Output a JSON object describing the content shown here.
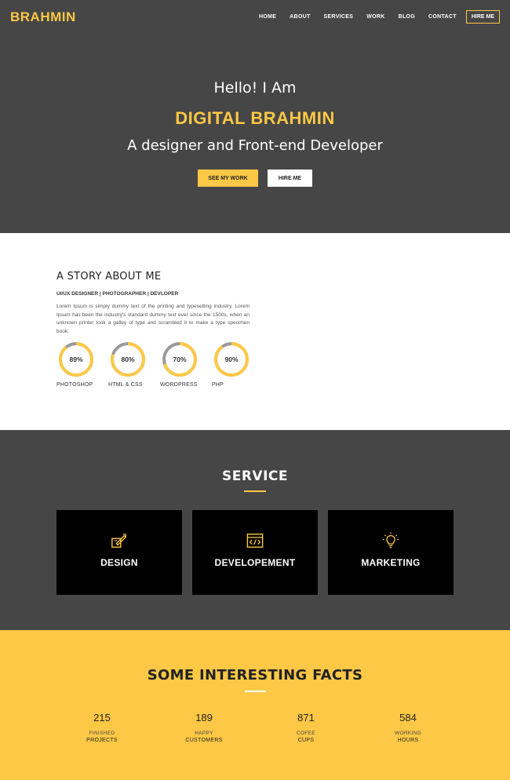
{
  "header": {
    "brand": "BRAHMIN",
    "nav": [
      "HOME",
      "ABOUT",
      "SERVICES",
      "WORK",
      "BLOG",
      "CONTACT"
    ],
    "cta": "HIRE ME"
  },
  "hero": {
    "greeting": "Hello! I Am",
    "name": "DIGITAL BRAHMIN",
    "tagline": "A designer and Front-end Developer",
    "primary_button": "SEE MY WORK",
    "secondary_button": "HIRE ME"
  },
  "about": {
    "title": "A STORY ABOUT ME",
    "roles": "UI/UX DESIGNER | PHOTOGRAPHER | DEVLOPER",
    "text": "Lorem Ipsum is simply dummy text of the printing and typesetting industry. Lorem Ipsum has been the industry's standard dummy text ever since the 1500s, when an unknown printer took a galley of type and scrambled it to make a type specimen book.",
    "skills": [
      {
        "label": "PHOTOSHOP",
        "value": "89%",
        "percent": 89
      },
      {
        "label": "HTML & CSS",
        "value": "80%",
        "percent": 80
      },
      {
        "label": "WORDPRESS",
        "value": "70%",
        "percent": 70
      },
      {
        "label": "PHP",
        "value": "90%",
        "percent": 90
      }
    ]
  },
  "services": {
    "title": "SERVICE",
    "items": [
      {
        "label": "DESIGN",
        "icon": "design-pencil-icon"
      },
      {
        "label": "DEVELOPEMENT",
        "icon": "code-window-icon"
      },
      {
        "label": "MARKETING",
        "icon": "lightbulb-icon"
      }
    ]
  },
  "facts": {
    "title": "SOME INTERESTING FACTS",
    "items": [
      {
        "number": "215",
        "line1": "FINISHED",
        "line2": "PROJECTS"
      },
      {
        "number": "189",
        "line1": "HAPPY",
        "line2": "CUSTOMERS"
      },
      {
        "number": "871",
        "line1": "COFEE",
        "line2": "CUPS"
      },
      {
        "number": "584",
        "line1": "WORKING",
        "line2": "HOURS"
      }
    ]
  },
  "colors": {
    "accent": "#fdc846",
    "dark": "#464646",
    "card": "#000000",
    "ring_track": "#9a9a9a"
  }
}
